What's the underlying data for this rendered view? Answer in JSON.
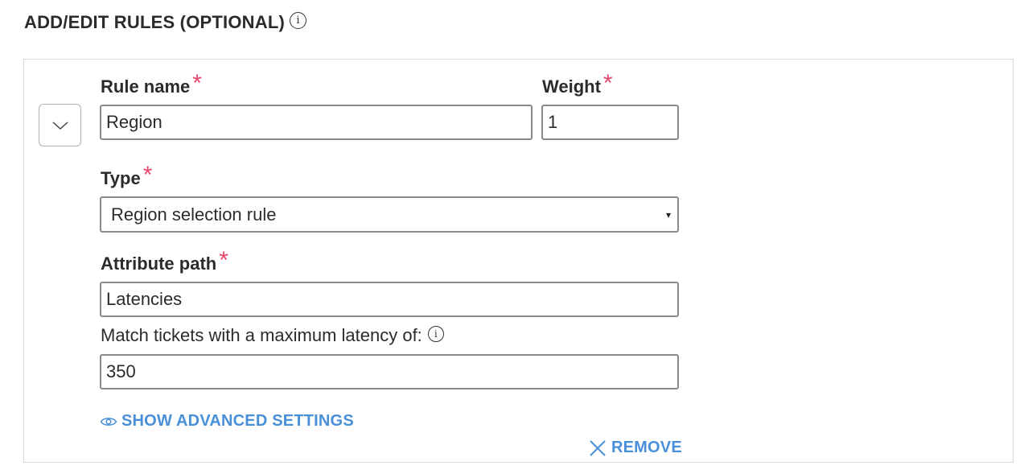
{
  "section": {
    "title": "ADD/EDIT RULES (OPTIONAL)",
    "info_icon": "info-icon"
  },
  "rule": {
    "collapse_icon": "chevron-down-icon",
    "rule_name": {
      "label": "Rule name",
      "required_mark": "*",
      "value": "Region"
    },
    "weight": {
      "label": "Weight",
      "required_mark": "*",
      "value": "1"
    },
    "type": {
      "label": "Type",
      "required_mark": "*",
      "selected": "Region selection rule",
      "caret": "▾"
    },
    "attribute_path": {
      "label": "Attribute path",
      "required_mark": "*",
      "value": "Latencies"
    },
    "max_latency": {
      "label": "Match tickets with a maximum latency of:",
      "value": "350"
    },
    "show_advanced": {
      "label": "SHOW ADVANCED SETTINGS",
      "icon": "eye-icon"
    },
    "remove": {
      "label": "REMOVE",
      "icon": "close-icon"
    }
  },
  "colors": {
    "required": "#e8456b",
    "link": "#4a90d9",
    "border": "#8a8a8a",
    "card_border": "#d9d9d9"
  }
}
